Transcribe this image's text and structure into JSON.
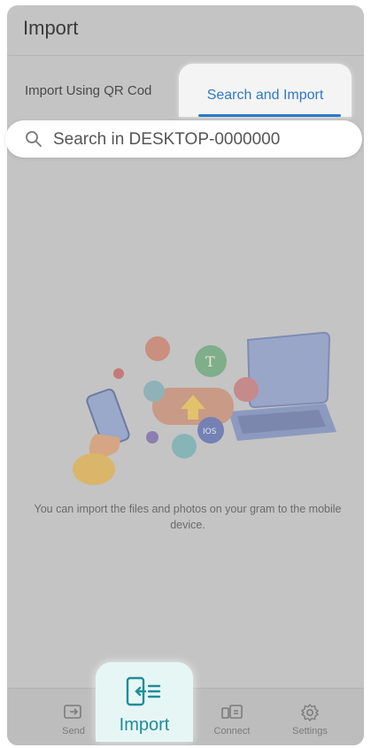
{
  "header": {
    "title": "Import"
  },
  "tabs": [
    {
      "label": "Import Using QR Cod",
      "active": false
    },
    {
      "label": "Search and Import",
      "active": true
    }
  ],
  "search": {
    "placeholder": "Search in DESKTOP-0000000",
    "icon": "search-icon"
  },
  "message": "You can import the files and photos on your gram to the mobile device.",
  "bottom_nav": [
    {
      "label": "Send",
      "icon": "send-icon",
      "active": false
    },
    {
      "label": "Import",
      "icon": "import-icon",
      "active": true
    },
    {
      "label": "Connect",
      "icon": "connect-icon",
      "active": false
    },
    {
      "label": "Settings",
      "icon": "gear-icon",
      "active": false
    }
  ],
  "colors": {
    "accent_blue": "#2f79c6",
    "accent_teal": "#1f8d9a",
    "dim_overlay": "#c4c4c4"
  }
}
